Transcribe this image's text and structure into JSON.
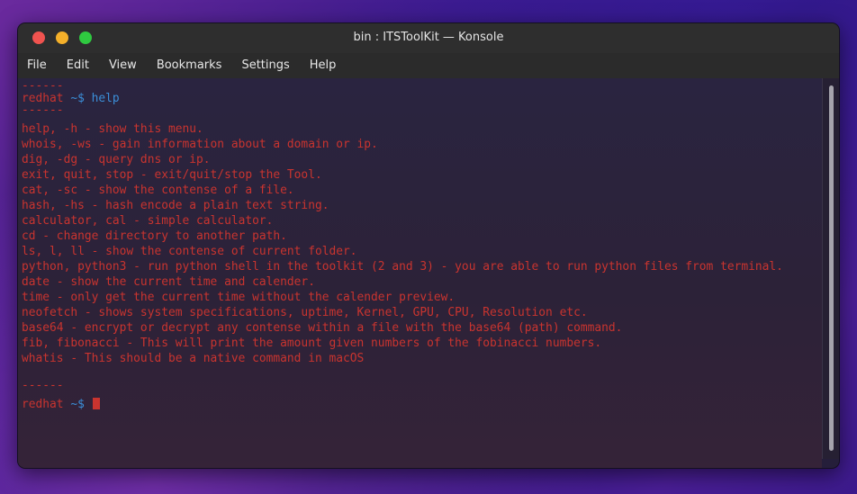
{
  "window": {
    "title": "bin : ITSToolKit — Konsole"
  },
  "menu": {
    "items": [
      "File",
      "Edit",
      "View",
      "Bookmarks",
      "Settings",
      "Help"
    ]
  },
  "terminal": {
    "separator": "------",
    "host": "redhat",
    "prompt_symbol": "~$",
    "command": "help",
    "help_lines": [
      "help, -h - show this menu.",
      "whois, -ws - gain information about a domain or ip.",
      "dig, -dg - query dns or ip.",
      "exit, quit, stop - exit/quit/stop the Tool.",
      "cat, -sc - show the contense of a file.",
      "hash, -hs - hash encode a plain text string.",
      "calculator, cal - simple calculator.",
      "cd - change directory to another path.",
      "ls, l, ll - show the contense of current folder.",
      "python, python3 - run python shell in the toolkit (2 and 3) - you are able to run python files from terminal.",
      "date - show the current time and calender.",
      "time - only get the current time without the calender preview.",
      "neofetch - shows system specifications, uptime, Kernel, GPU, CPU, Resolution etc.",
      "base64 - encrypt or decrypt any contense within a file with the base64 (path) command.",
      "fib, fibonacci - This will print the amount given numbers of the fobinacci numbers.",
      "whatis - This should be a native command in macOS"
    ]
  },
  "colors": {
    "text_red": "#c9342f",
    "prompt_blue": "#3b8fd9",
    "close": "#f0534f",
    "minimize": "#f4b02a",
    "maximize": "#2fc940"
  }
}
